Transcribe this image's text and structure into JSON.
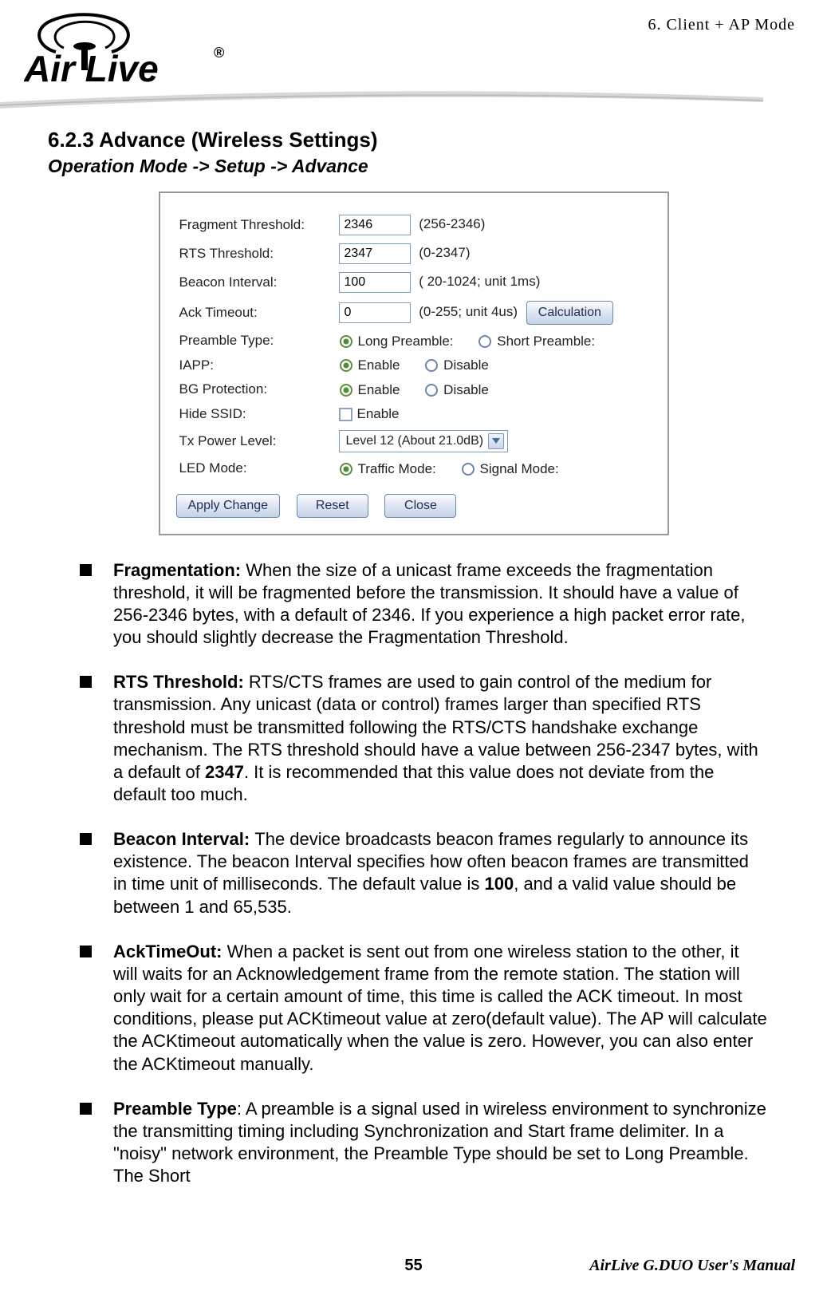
{
  "header": {
    "chapter_ref": "6.   Client + AP Mode",
    "logo_text_1": "Air Live",
    "logo_text_2": "®"
  },
  "section": {
    "heading": "6.2.3 Advance (Wireless Settings)",
    "breadcrumb": "Operation Mode -> Setup -> Advance"
  },
  "panel": {
    "frag_label": "Fragment Threshold:",
    "frag_value": "2346",
    "frag_hint": "(256-2346)",
    "rts_label": "RTS Threshold:",
    "rts_value": "2347",
    "rts_hint": "(0-2347)",
    "beacon_label": "Beacon Interval:",
    "beacon_value": "100",
    "beacon_hint": "( 20-1024; unit 1ms)",
    "ack_label": "Ack Timeout:",
    "ack_value": "0",
    "ack_hint": "(0-255; unit 4us)",
    "calc_btn": "Calculation",
    "preamble_label": "Preamble Type:",
    "preamble_long": "Long Preamble:",
    "preamble_short": "Short Preamble:",
    "iapp_label": "IAPP:",
    "enable": "Enable",
    "disable": "Disable",
    "bg_label": "BG Protection:",
    "hide_label": "Hide SSID:",
    "tx_label": "Tx Power Level:",
    "tx_value": "Level 12 (About 21.0dB)",
    "led_label": "LED Mode:",
    "led_traffic": "Traffic Mode:",
    "led_signal": "Signal Mode:",
    "apply_btn": "Apply Change",
    "reset_btn": "Reset",
    "close_btn": "Close"
  },
  "bullets": {
    "b1_title": "Fragmentation: ",
    "b1_text": "When the size of a unicast frame exceeds the fragmentation threshold, it will be fragmented before the transmission. It should have a value of 256-2346 bytes, with a default of 2346.    If you experience a high packet error rate, you should slightly decrease the Fragmentation Threshold.",
    "b2_title": "RTS Threshold: ",
    "b2_text_a": "RTS/CTS frames are used to gain control of the medium for transmission. Any unicast (data or control) frames larger than specified RTS threshold must be transmitted following the RTS/CTS handshake exchange mechanism. The RTS threshold should have a value between 256-2347 bytes, with a default of ",
    "b2_bold": "2347",
    "b2_text_b": ". It is recommended that this value does not deviate from the default too much.",
    "b3_title": "Beacon Interval: ",
    "b3_text_a": "The device broadcasts beacon frames regularly to announce its existence. The beacon Interval specifies how often beacon frames are transmitted in time unit of milliseconds. The default value is ",
    "b3_bold": "100",
    "b3_text_b": ", and a valid value should be between 1 and 65,535.",
    "b4_title": "AckTimeOut:",
    "b4_text": "   When a packet is sent out from one wireless station to the other, it will waits for an Acknowledgement frame from the remote station.    The station will only wait for a certain amount of time, this time is called the ACK timeout.    In most conditions, please put ACKtimeout value at zero(default value).    The AP will calculate the ACKtimeout automatically when the value is zero.    However, you can also enter the ACKtimeout manually.",
    "b5_title": "Preamble Type",
    "b5_text": ": A preamble is a signal used in wireless environment to synchronize the transmitting timing including Synchronization and Start frame delimiter. In a \"noisy\" network environment, the Preamble Type should be set to Long Preamble. The Short"
  },
  "footer": {
    "page": "55",
    "manual": "AirLive G.DUO User's Manual"
  }
}
